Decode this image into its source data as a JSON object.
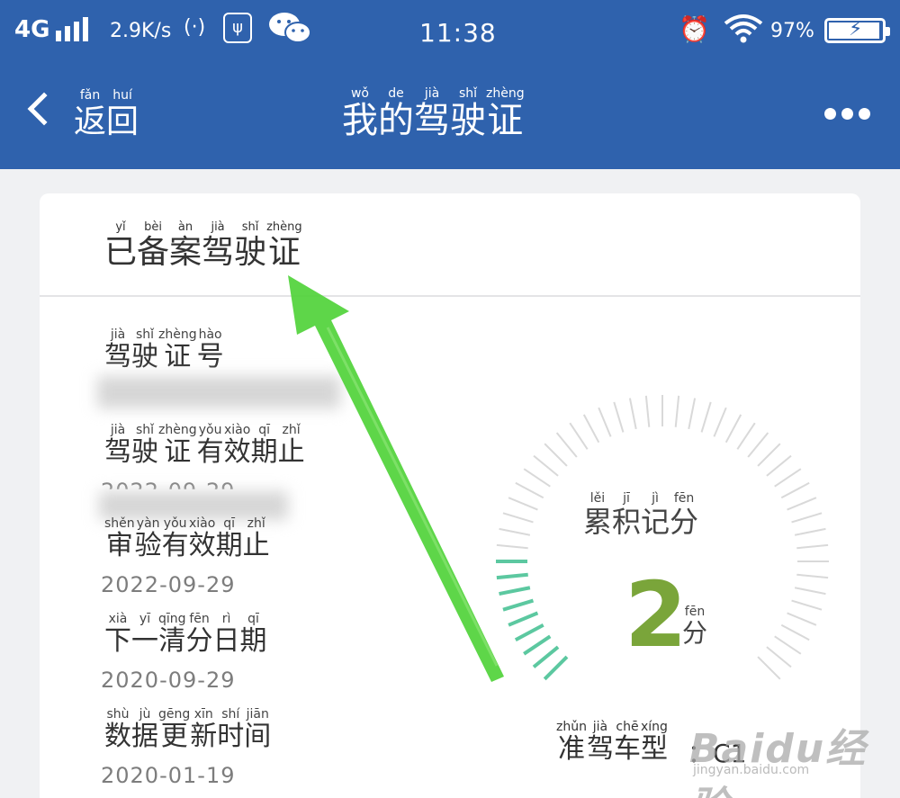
{
  "status_bar": {
    "network": "4G",
    "speed": "2.9K/s",
    "time": "11:38",
    "battery_percent": "97%",
    "battery_level": 0.97,
    "icons": [
      "signal-icon",
      "hotspot-icon",
      "usb-icon",
      "wechat-icon",
      "alarm-icon",
      "wifi-icon",
      "battery-icon"
    ]
  },
  "nav": {
    "back": [
      {
        "py": "fǎn",
        "hz": "返"
      },
      {
        "py": "huí",
        "hz": "回"
      }
    ],
    "title": [
      {
        "py": "wǒ",
        "hz": "我"
      },
      {
        "py": "de",
        "hz": "的"
      },
      {
        "py": "jià",
        "hz": "驾"
      },
      {
        "py": "shǐ",
        "hz": "驶"
      },
      {
        "py": "zhèng",
        "hz": "证"
      }
    ]
  },
  "card": {
    "header": [
      {
        "py": "yǐ",
        "hz": "已"
      },
      {
        "py": "bèi",
        "hz": "备"
      },
      {
        "py": "àn",
        "hz": "案"
      },
      {
        "py": "jià",
        "hz": "驾"
      },
      {
        "py": "shǐ",
        "hz": "驶"
      },
      {
        "py": "zhèng",
        "hz": "证"
      }
    ],
    "fields": {
      "license_no": {
        "label": [
          {
            "py": "jià",
            "hz": "驾"
          },
          {
            "py": "shǐ",
            "hz": "驶"
          },
          {
            "py": "zhèng",
            "hz": "证"
          },
          {
            "py": "hào",
            "hz": "号"
          }
        ]
      },
      "license_expiry": {
        "label": [
          {
            "py": "jià",
            "hz": "驾"
          },
          {
            "py": "shǐ",
            "hz": "驶"
          },
          {
            "py": "zhèng",
            "hz": "证"
          },
          {
            "py": "yǒu",
            "hz": "有"
          },
          {
            "py": "xiào",
            "hz": "效"
          },
          {
            "py": "qī",
            "hz": "期"
          },
          {
            "py": "zhǐ",
            "hz": "止"
          }
        ],
        "value": "2022-09-29"
      },
      "inspection_expiry": {
        "label": [
          {
            "py": "shěn",
            "hz": "审"
          },
          {
            "py": "yàn",
            "hz": "验"
          },
          {
            "py": "yǒu",
            "hz": "有"
          },
          {
            "py": "xiào",
            "hz": "效"
          },
          {
            "py": "qī",
            "hz": "期"
          },
          {
            "py": "zhǐ",
            "hz": "止"
          }
        ],
        "value": "2022-09-29"
      },
      "next_clear_date": {
        "label": [
          {
            "py": "xià",
            "hz": "下"
          },
          {
            "py": "yī",
            "hz": "一"
          },
          {
            "py": "qīng",
            "hz": "清"
          },
          {
            "py": "fēn",
            "hz": "分"
          },
          {
            "py": "rì",
            "hz": "日"
          },
          {
            "py": "qī",
            "hz": "期"
          }
        ],
        "value": "2020-09-29"
      },
      "data_update_time": {
        "label": [
          {
            "py": "shù",
            "hz": "数"
          },
          {
            "py": "jù",
            "hz": "据"
          },
          {
            "py": "gēng",
            "hz": "更"
          },
          {
            "py": "xīn",
            "hz": "新"
          },
          {
            "py": "shí",
            "hz": "时"
          },
          {
            "py": "jiān",
            "hz": "间"
          }
        ],
        "value": "2020-01-19"
      }
    },
    "score": {
      "label": [
        {
          "py": "lěi",
          "hz": "累"
        },
        {
          "py": "jī",
          "hz": "积"
        },
        {
          "py": "jì",
          "hz": "记"
        },
        {
          "py": "fēn",
          "hz": "分"
        }
      ],
      "value": "2",
      "unit": [
        {
          "py": "fēn",
          "hz": "分"
        }
      ],
      "gauge_max": 12,
      "accent_color": "#7aa53a",
      "active_tick_color": "#5cc8a0",
      "inactive_tick_color": "#d9d9d9"
    },
    "car_type": {
      "label": [
        {
          "py": "zhǔn",
          "hz": "准"
        },
        {
          "py": "jià",
          "hz": "驾"
        },
        {
          "py": "chē",
          "hz": "车"
        },
        {
          "py": "xíng",
          "hz": "型"
        }
      ],
      "separator": "：",
      "value": "C1"
    }
  },
  "watermark": {
    "brand": "Baidu经验",
    "site": "jingyan.baidu.com"
  },
  "colors": {
    "header_bg": "#2f62ad",
    "card_bg": "#ffffff",
    "page_bg": "#f0f1f3",
    "annotation_arrow": "#4cd235"
  }
}
